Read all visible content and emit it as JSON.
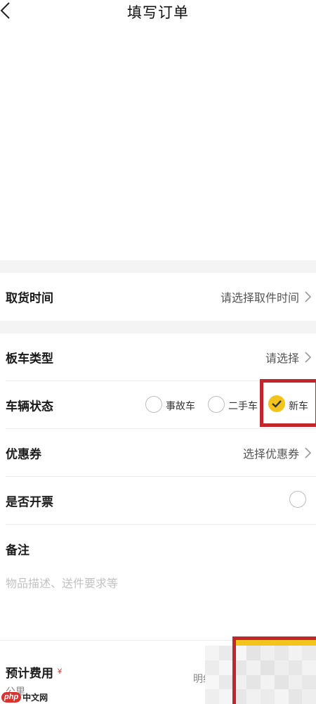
{
  "header": {
    "title": "填写订单"
  },
  "form": {
    "pickup_time": {
      "label": "取货时间",
      "value": "请选择取件时间"
    },
    "trailer_type": {
      "label": "板车类型",
      "value": "请选择"
    },
    "vehicle_status": {
      "label": "车辆状态",
      "options": [
        {
          "label": "事故车",
          "selected": false
        },
        {
          "label": "二手车",
          "selected": false
        },
        {
          "label": "新车",
          "selected": true
        }
      ]
    },
    "coupon": {
      "label": "优惠券",
      "value": "选择优惠券"
    },
    "invoice": {
      "label": "是否开票",
      "checked": false
    },
    "notes": {
      "label": "备注",
      "placeholder": "物品描述、送件要求等"
    }
  },
  "footer": {
    "fee_label": "预计费用",
    "currency": "¥",
    "distance_unit": "公里",
    "detail_label": "明细"
  },
  "watermark": {
    "badge": "php",
    "text": "中文网"
  },
  "colors": {
    "accent": "#f3c51c",
    "highlight": "#c0262c",
    "background_gap": "#f4f4f4"
  }
}
